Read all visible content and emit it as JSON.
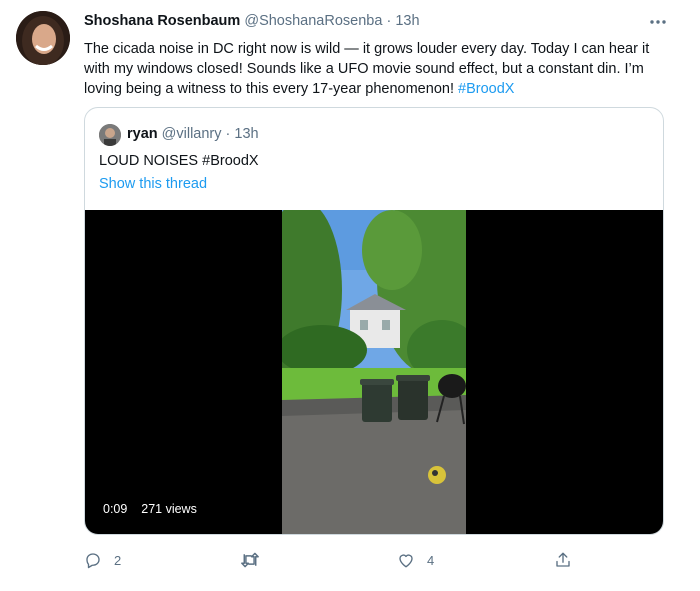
{
  "tweet": {
    "author_name": "Shoshana Rosenbaum",
    "author_handle": "@ShoshanaRosenba",
    "separator": "·",
    "time": "13h",
    "text_part1": "The cicada noise in DC right now is wild — it grows louder every day. Today I can hear it with my windows closed! Sounds like a UFO movie sound effect, but a constant din. I’m loving being a witness to this every 17-year phenomenon! ",
    "hashtag": "#BroodX"
  },
  "quoted": {
    "author_name": "ryan",
    "author_handle": "@villanry",
    "separator": "·",
    "time": "13h",
    "text": "LOUD NOISES #BroodX",
    "show_thread": "Show this thread",
    "video": {
      "duration": "0:09",
      "views": "271 views"
    }
  },
  "actions": {
    "reply_count": "2",
    "retweet_count": "",
    "like_count": "4"
  },
  "colors": {
    "link": "#1d9bf0",
    "muted": "#5b7083"
  },
  "icons": [
    "more-icon",
    "reply-icon",
    "retweet-icon",
    "like-icon",
    "share-icon"
  ]
}
